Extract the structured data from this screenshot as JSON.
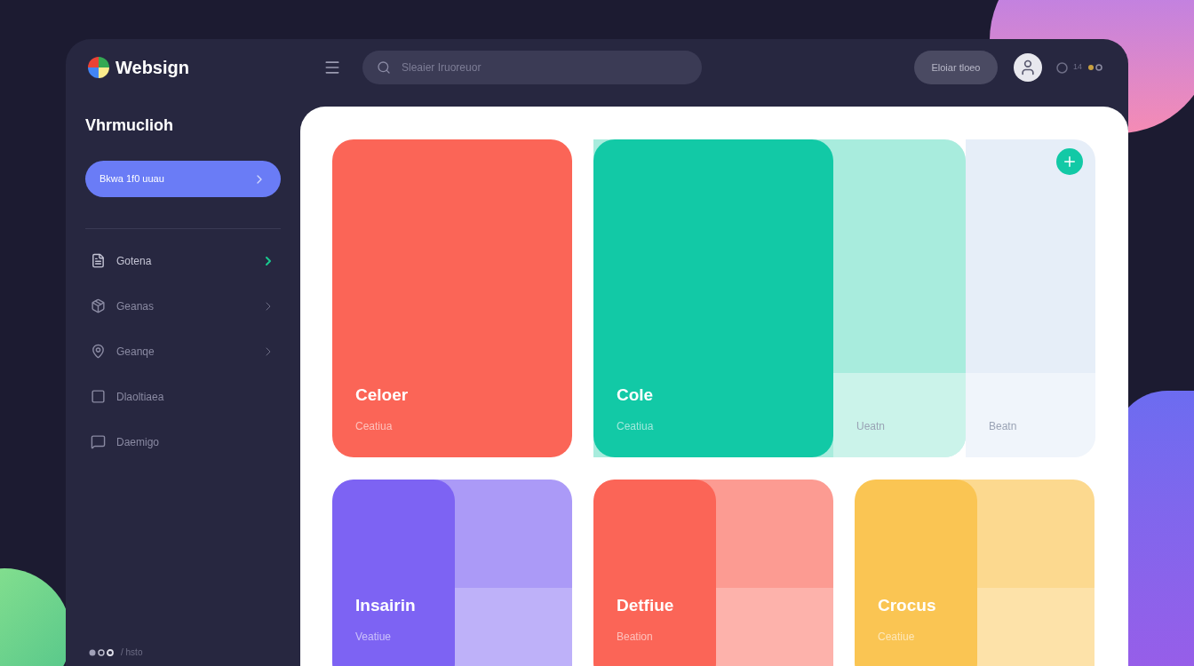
{
  "header": {
    "brand": "Websign",
    "search": {
      "placeholder": "Sleaier Iruoreuor"
    },
    "button": "Eloiar tloeo",
    "status_count": "14"
  },
  "sidebar": {
    "title": "Vhrmuclioh",
    "primary_button": "Bkwa 1f0 uuau",
    "items": [
      {
        "label": "Gotena",
        "selected": true,
        "chevron": true
      },
      {
        "label": "Geanas",
        "selected": false,
        "chevron": true
      },
      {
        "label": "Geanqe",
        "selected": false,
        "chevron": true
      },
      {
        "label": "Dlaoltiaea",
        "selected": false,
        "chevron": false
      },
      {
        "label": "Daemigo",
        "selected": false,
        "chevron": false
      }
    ],
    "footer": "/ hsto"
  },
  "top_cards": [
    {
      "kind": "solid",
      "color": "#fb6557",
      "title": "Celoer",
      "subtitle": "Ceatiua"
    },
    {
      "kind": "stacked",
      "panels": [
        {
          "color": "#12c9a6",
          "title": "Cole",
          "subtitle": "Ceatiua"
        },
        {
          "color": "#a8ecdd",
          "subtitle": "Ueatn"
        },
        {
          "color": "#e6eef8",
          "subtitle": "Beatn"
        }
      ]
    }
  ],
  "bottom_cards": [
    {
      "color": "#7d63f3",
      "title": "Insairin",
      "subtitle": "Veatiue"
    },
    {
      "color": "#fb6557",
      "title": "Detfiue",
      "subtitle": "Beation"
    },
    {
      "color": "#fac553",
      "title": "Crocus",
      "subtitle": "Ceatiue"
    }
  ]
}
